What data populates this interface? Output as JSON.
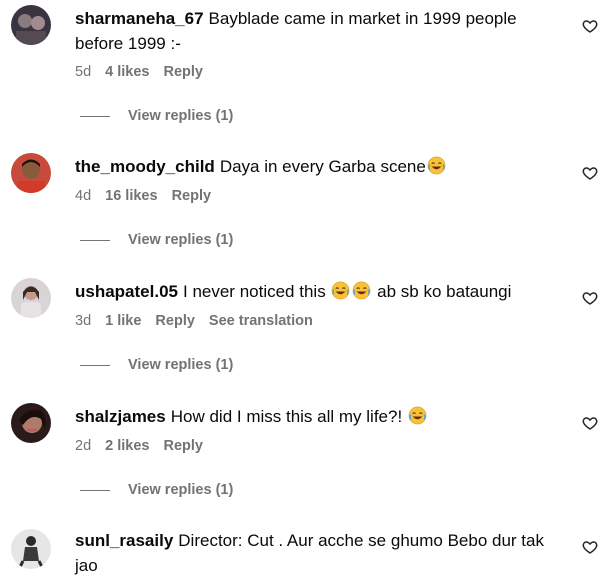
{
  "comments": [
    {
      "username": "sharmaneha_67",
      "text": "Bayblade came in market in 1999 people before 1999 :-",
      "time": "5d",
      "likes": "4 likes",
      "reply": "Reply",
      "view_replies": "View replies (1)"
    },
    {
      "username": "the_moody_child",
      "text": "Daya in every Garba scene",
      "time": "4d",
      "likes": "16 likes",
      "reply": "Reply",
      "view_replies": "View replies (1)"
    },
    {
      "username": "ushapatel.05",
      "text_before": "I never noticed this",
      "text_after": "ab sb ko bataungi",
      "time": "3d",
      "likes": "1 like",
      "reply": "Reply",
      "translate": "See translation",
      "view_replies": "View replies (1)"
    },
    {
      "username": "shalzjames",
      "text": "How did I miss this all my life?!",
      "time": "2d",
      "likes": "2 likes",
      "reply": "Reply",
      "view_replies": "View replies (1)"
    },
    {
      "username": "sunl_rasaily",
      "text": "Director: Cut . Aur acche se ghumo Bebo dur tak jao"
    }
  ],
  "icons": {
    "like": "heart-outline-icon",
    "emoji": "face-with-tears-of-joy-emoji"
  }
}
